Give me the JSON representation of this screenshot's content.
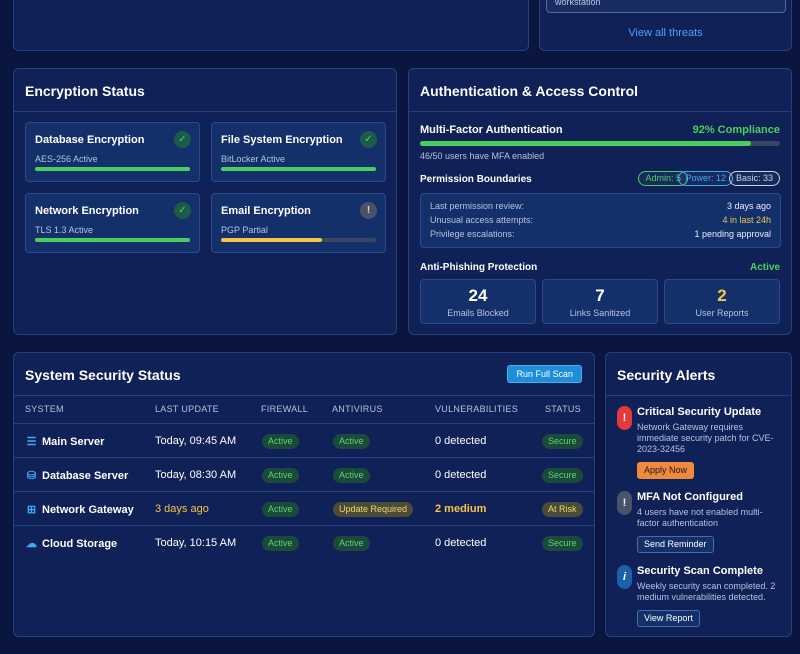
{
  "threats": {
    "partial_item": "workstation",
    "view_all": "View all threats"
  },
  "encryption": {
    "title": "Encryption Status",
    "items": [
      {
        "name": "Database Encryption",
        "detail": "AES-256 Active",
        "status": "ok",
        "progress": 1.0
      },
      {
        "name": "File System Encryption",
        "detail": "BitLocker Active",
        "status": "ok",
        "progress": 1.0
      },
      {
        "name": "Network Encryption",
        "detail": "TLS 1.3 Active",
        "status": "ok",
        "progress": 1.0
      },
      {
        "name": "Email Encryption",
        "detail": "PGP Partial",
        "status": "warning",
        "progress": 0.65
      }
    ],
    "ok_glyph": "✓",
    "warn_glyph": "!"
  },
  "auth": {
    "title": "Authentication & Access Control",
    "mfa": {
      "label": "Multi-Factor Authentication",
      "compliance": "92% Compliance",
      "progress": 0.92,
      "summary": "46/50 users have MFA enabled"
    },
    "permissions": {
      "label": "Permission Boundaries",
      "pills": [
        {
          "text": "Admin: 5",
          "color": "#47d05e"
        },
        {
          "text": "Power: 12",
          "color": "#3fa8f5"
        },
        {
          "text": "Basic: 33",
          "color": "#c9d2e6"
        }
      ],
      "rows": [
        {
          "label": "Last permission review:",
          "value": "3 days ago",
          "color": "#e8eefc"
        },
        {
          "label": "Unusual access attempts:",
          "value": "4 in last 24h",
          "color": "#f6c445"
        },
        {
          "label": "Privilege escalations:",
          "value": "1 pending approval",
          "color": "#e8eefc"
        }
      ]
    },
    "phishing": {
      "label": "Anti-Phishing Protection",
      "status": "Active",
      "stats": [
        {
          "value": "24",
          "label": "Emails Blocked",
          "color": "#ffffff"
        },
        {
          "value": "7",
          "label": "Links Sanitized",
          "color": "#ffffff"
        },
        {
          "value": "2",
          "label": "User Reports",
          "color": "#f6c445"
        }
      ]
    }
  },
  "system": {
    "title": "System Security Status",
    "scan_button": "Run Full Scan",
    "columns": [
      "SYSTEM",
      "LAST UPDATE",
      "FIREWALL",
      "ANTIVIRUS",
      "VULNERABILITIES",
      "STATUS"
    ],
    "rows": [
      {
        "icon": "server-icon",
        "glyph": "☰",
        "name": "Main Server",
        "updated": "Today, 09:45 AM",
        "firewall": "Active",
        "antivirus": "Active",
        "vulns": "0 detected",
        "status": "Secure",
        "warn": false
      },
      {
        "icon": "database-icon",
        "glyph": "⛁",
        "name": "Database Server",
        "updated": "Today, 08:30 AM",
        "firewall": "Active",
        "antivirus": "Active",
        "vulns": "0 detected",
        "status": "Secure",
        "warn": false
      },
      {
        "icon": "network-icon",
        "glyph": "⊞",
        "name": "Network Gateway",
        "updated": "3 days ago",
        "firewall": "Active",
        "antivirus": "Update Required",
        "vulns": "2 medium",
        "status": "At Risk",
        "warn": true
      },
      {
        "icon": "cloud-icon",
        "glyph": "☁",
        "name": "Cloud Storage",
        "updated": "Today, 10:15 AM",
        "firewall": "Active",
        "antivirus": "Active",
        "vulns": "0 detected",
        "status": "Secure",
        "warn": false
      }
    ]
  },
  "alerts": {
    "title": "Security Alerts",
    "items": [
      {
        "title": "Critical Security Update",
        "desc": "Network Gateway requires immediate security patch for CVE-2023-32456",
        "button": "Apply Now",
        "glyph": "!",
        "kind": "critical"
      },
      {
        "title": "MFA Not Configured",
        "desc": "4 users have not enabled multi-factor authentication",
        "button": "Send Reminder",
        "glyph": "!",
        "kind": "warning"
      },
      {
        "title": "Security Scan Complete",
        "desc": "Weekly security scan completed. 2 medium vulnerabilities detected.",
        "button": "View Report",
        "glyph": "i",
        "kind": "info"
      }
    ]
  },
  "colors": {
    "green": "#47d05e",
    "yellow": "#f6c445",
    "blue": "#3fa8f5",
    "critical": "#e03b3b",
    "orange_button": "#f0883e"
  }
}
